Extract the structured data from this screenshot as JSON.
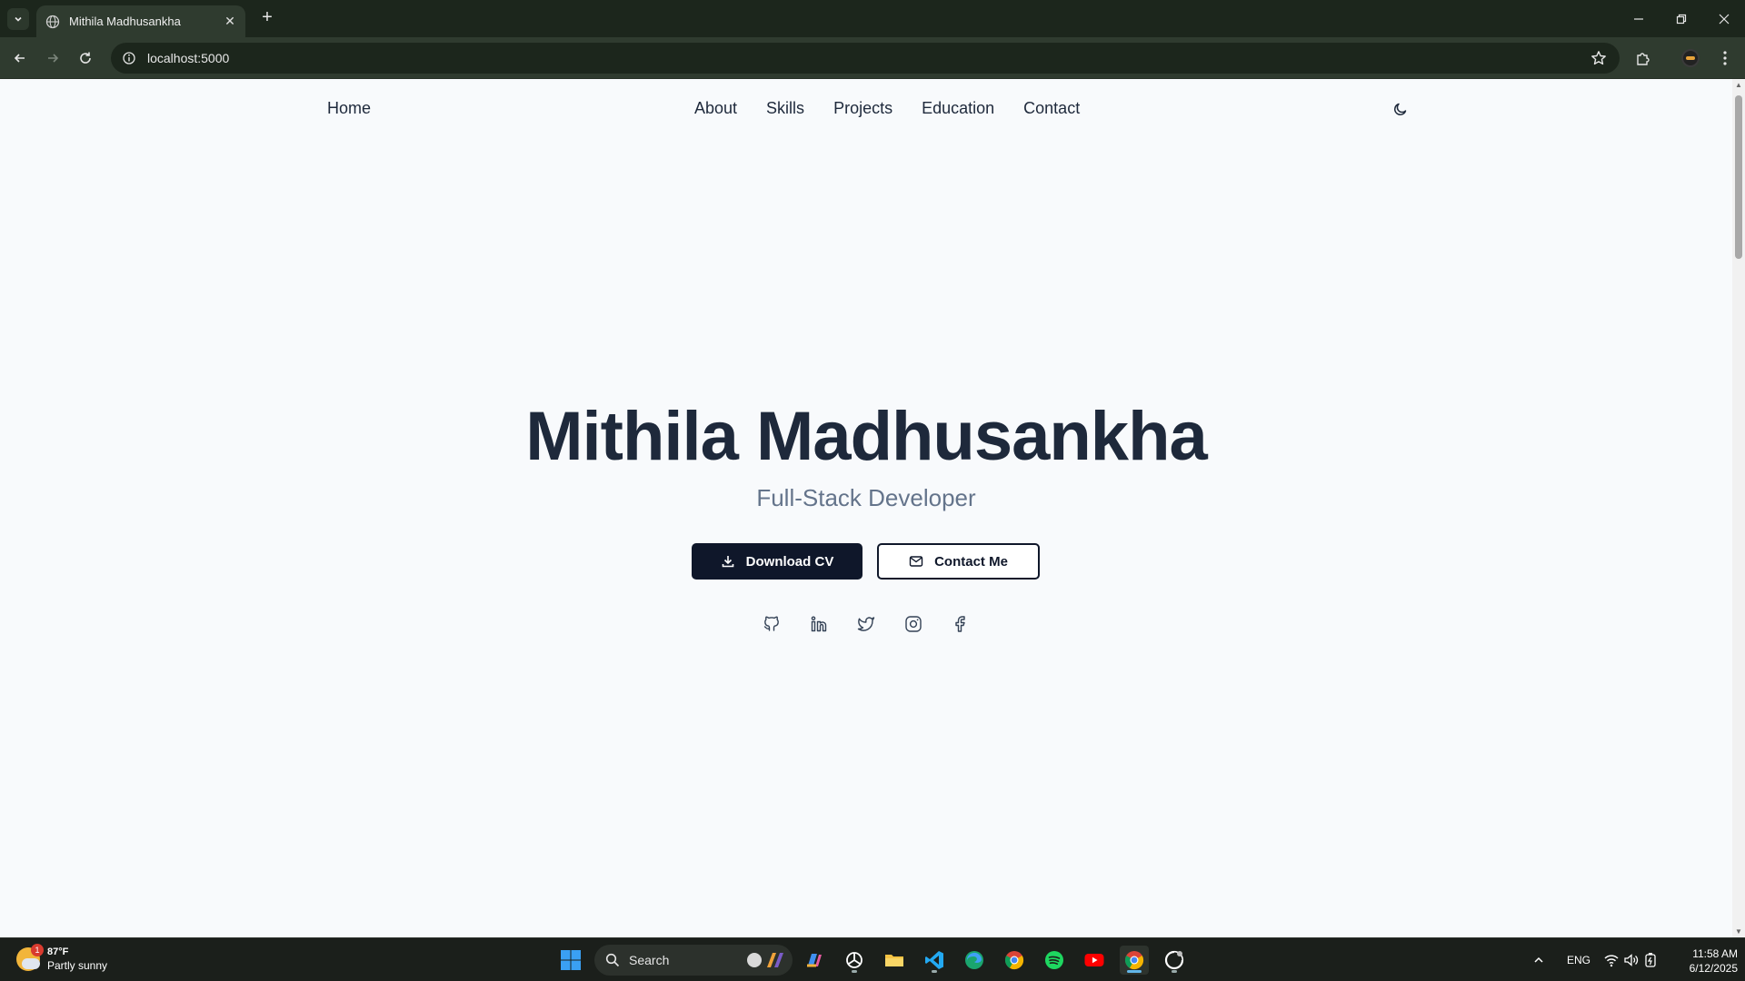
{
  "browser": {
    "tab_title": "Mithila Madhusankha",
    "url": "localhost:5000"
  },
  "nav": {
    "home": "Home",
    "links": [
      "About",
      "Skills",
      "Projects",
      "Education",
      "Contact"
    ]
  },
  "hero": {
    "name": "Mithila Madhusankha",
    "role": "Full-Stack Developer",
    "primary_button": "Download CV",
    "secondary_button": "Contact Me",
    "socials": [
      "github-icon",
      "linkedin-icon",
      "twitter-icon",
      "instagram-icon",
      "facebook-icon"
    ]
  },
  "taskbar": {
    "weather_temp": "87°F",
    "weather_condition": "Partly sunny",
    "weather_badge": "1",
    "search_label": "Search",
    "language": "ENG",
    "time": "11:58 AM",
    "date": "6/12/2025"
  },
  "colors": {
    "page_bg": "#f8fafc",
    "text_dark": "#1e293b",
    "text_muted": "#64748b",
    "button_dark": "#0f172a",
    "browser_frame": "#1c261c"
  }
}
